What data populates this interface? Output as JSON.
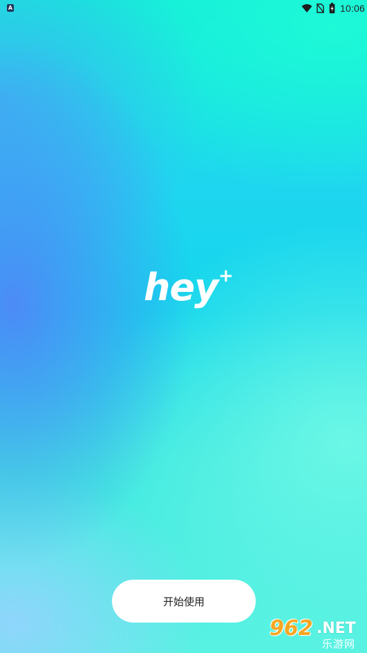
{
  "status_bar": {
    "left_icon_letter": "A",
    "left_icon_name": "accessibility-icon",
    "icons": [
      "wifi-icon",
      "no-sim-icon",
      "battery-icon"
    ],
    "time": "10:06"
  },
  "splash": {
    "logo_text": "hey",
    "logo_plus": "+",
    "start_button_label": "开始使用"
  },
  "watermark": {
    "number": "962",
    "domain": ".NET",
    "site_name": "乐游网"
  },
  "colors": {
    "background_top": "#13ecd9",
    "background_mid": "#14d6ec",
    "background_bottom": "#58f2e2",
    "left_blue": "#4f87f7",
    "button_bg": "#ffffff",
    "button_text": "#222222",
    "logo": "#ffffff",
    "watermark_orange": "#f5a623"
  }
}
